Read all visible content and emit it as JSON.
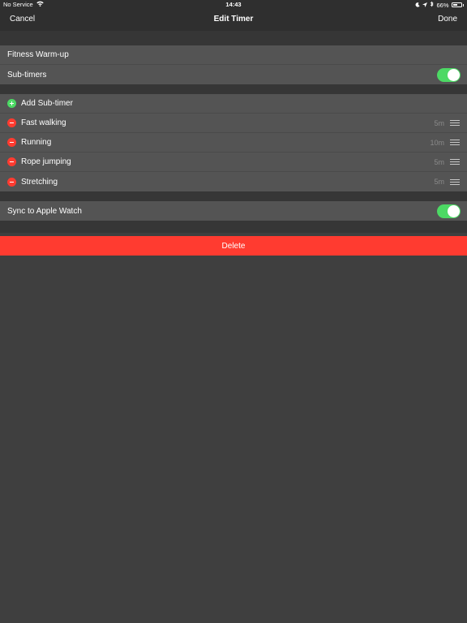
{
  "status_bar": {
    "carrier": "No Service",
    "wifi_icon": "wifi-icon",
    "time": "14:43",
    "moon_icon": "moon-icon",
    "location_icon": "location-arrow-icon",
    "bluetooth_icon": "bluetooth-icon",
    "battery_percent": "66%",
    "battery_level": 0.66
  },
  "nav": {
    "cancel_label": "Cancel",
    "title": "Edit Timer",
    "done_label": "Done"
  },
  "timer": {
    "name": "Fitness Warm-up",
    "subtimers_label": "Sub-timers",
    "subtimers_enabled": true
  },
  "subtimers": {
    "add_label": "Add Sub-timer",
    "items": [
      {
        "label": "Fast walking",
        "duration": "5m"
      },
      {
        "label": "Running",
        "duration": "10m"
      },
      {
        "label": "Rope jumping",
        "duration": "5m"
      },
      {
        "label": "Stretching",
        "duration": "5m"
      }
    ]
  },
  "watch": {
    "sync_label": "Sync to Apple Watch",
    "sync_enabled": true
  },
  "delete_label": "Delete",
  "colors": {
    "background": "#3f3f3f",
    "row": "#545454",
    "toggle_on": "#4cd964",
    "add": "#4cd964",
    "remove": "#ff3b30",
    "destructive": "#ff3b30"
  }
}
